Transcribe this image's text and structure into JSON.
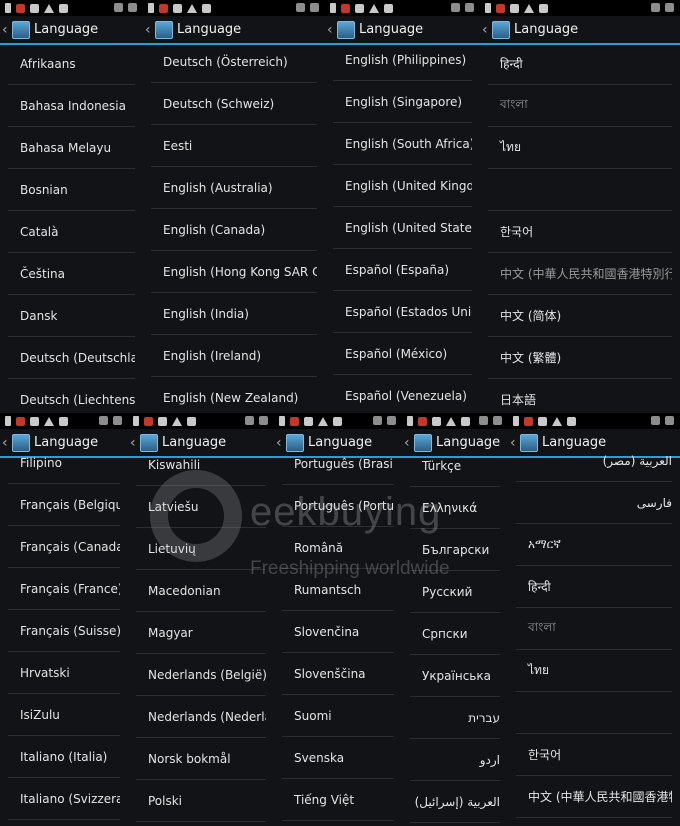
{
  "title": "Language",
  "panels": [
    {
      "items": [
        "Afrikaans",
        "Bahasa Indonesia",
        "Bahasa Melayu",
        "Bosnian",
        "Català",
        "Čeština",
        "Dansk",
        "Deutsch (Deutschland)",
        "Deutsch (Liechtenstein)"
      ]
    },
    {
      "items": [
        "Deutsch (Österreich)",
        "Deutsch (Schweiz)",
        "Eesti",
        "English (Australia)",
        "English (Canada)",
        "English (Hong Kong SAR China)",
        "English (India)",
        "English (Ireland)",
        "English (New Zealand)"
      ]
    },
    {
      "items": [
        "English (Philippines)",
        "English (Singapore)",
        "English (South Africa)",
        "English (United Kingdom)",
        "English (United States)",
        "Español (España)",
        "Español (Estados Unidos)",
        "Español (México)",
        "Español (Venezuela)"
      ]
    },
    {
      "items": [
        "हिन्दी",
        "বাংলা",
        "ไทย",
        "",
        "한국어",
        "中文 (中華人民共和國香港特別行政區)",
        "中文 (简体)",
        "中文 (繁體)",
        "日本語"
      ]
    },
    {
      "items": [
        "Filipino",
        "Français (Belgique)",
        "Français (Canada)",
        "Français (France)",
        "Français (Suisse)",
        "Hrvatski",
        "IsiZulu",
        "Italiano (Italia)",
        "Italiano (Svizzera)"
      ]
    },
    {
      "items": [
        "Kiswahili",
        "Latviešu",
        "Lietuvių",
        "Macedonian",
        "Magyar",
        "Nederlands (België)",
        "Nederlands (Nederland)",
        "Norsk bokmål",
        "Polski"
      ]
    },
    {
      "items": [
        "Português (Brasil)",
        "Português (Portugal)",
        "Română",
        "Rumantsch",
        "Slovenčina",
        "Slovenščina",
        "Suomi",
        "Svenska",
        "Tiếng Việt"
      ]
    },
    {
      "items": [
        "Türkçe",
        "Ελληνικά",
        "Български",
        "Русский",
        "Српски",
        "Українська",
        "עברית",
        "اردو",
        "العربية (إسرائيل)"
      ]
    },
    {
      "items": [
        "العربية (مصر)",
        "فارسی",
        "አማርኛ",
        "हिन्दी",
        "বাংলা",
        "ไทย",
        "",
        "한국어",
        "中文 (中華人民共和國香港特別行政區)"
      ]
    }
  ],
  "watermark": {
    "brand": "eekbuying",
    "tagline": "Freeshipping worldwide"
  }
}
